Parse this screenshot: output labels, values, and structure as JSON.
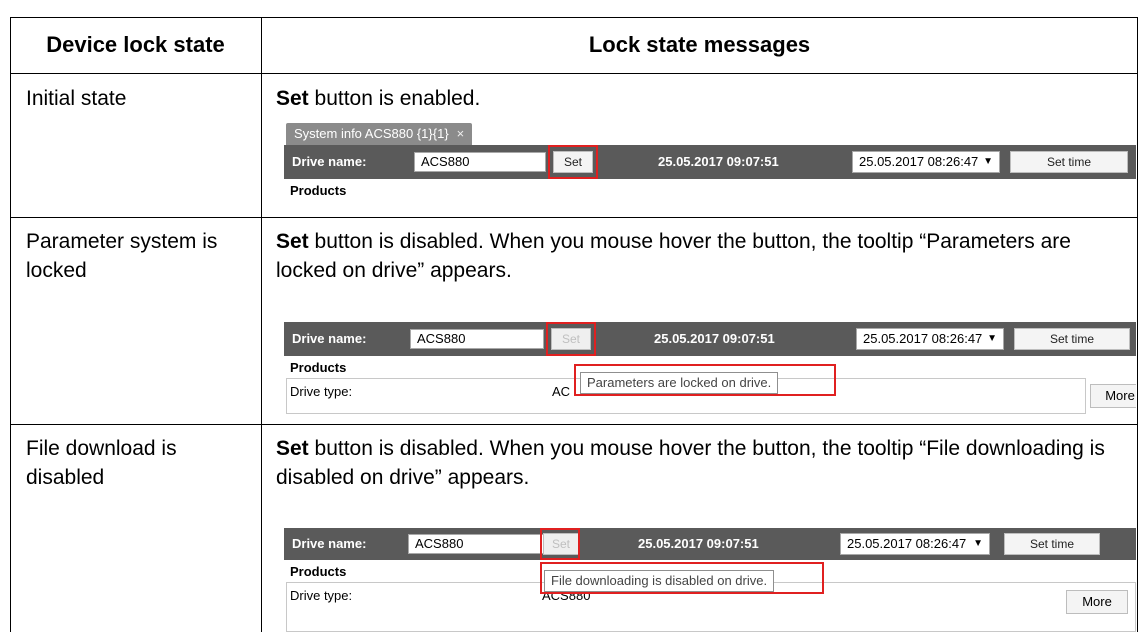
{
  "table": {
    "header_col1": "Device lock state",
    "header_col2": "Lock state messages"
  },
  "rows": [
    {
      "state": "Initial state",
      "msg_bold": "Set",
      "msg_rest": " button is enabled.",
      "shot": {
        "tab_label": "System info ACS880 {1}{1}",
        "close_glyph": "×",
        "drive_name_label": "Drive name:",
        "drive_name_value": "ACS880",
        "set_label": "Set",
        "timestamp": "25.05.2017 09:07:51",
        "time_select": "25.05.2017 08:26:47",
        "set_time_label": "Set time",
        "products_label": "Products"
      }
    },
    {
      "state": "Parameter system is locked",
      "msg_bold": "Set",
      "msg_rest": " button is disabled. When you mouse hover the button, the tooltip “Parameters are locked on drive” appears.",
      "shot": {
        "drive_name_label": "Drive name:",
        "drive_name_value": "ACS880",
        "set_label": "Set",
        "timestamp": "25.05.2017 09:07:51",
        "time_select": "25.05.2017 08:26:47",
        "set_time_label": "Set time",
        "products_label": "Products",
        "drive_type_label": "Drive type:",
        "drive_type_value": "AC",
        "tooltip": "Parameters are locked on drive.",
        "more_label": "More"
      }
    },
    {
      "state": "File download is disabled",
      "msg_bold": "Set",
      "msg_rest": " button is disabled. When you mouse hover the button, the tooltip “File downloading is disabled on drive” appears.",
      "shot": {
        "drive_name_label": "Drive name:",
        "drive_name_value": "ACS880",
        "set_label": "Set",
        "timestamp": "25.05.2017 09:07:51",
        "time_select": "25.05.2017 08:26:47",
        "set_time_label": "Set time",
        "products_label": "Products",
        "drive_type_label": "Drive type:",
        "drive_type_value": "ACS880",
        "tooltip": "File downloading is disabled on drive.",
        "more_label": "More"
      }
    }
  ],
  "colors": {
    "highlight": "#e02020",
    "toolbar": "#5a5a5a",
    "tab": "#8b8b8b"
  }
}
